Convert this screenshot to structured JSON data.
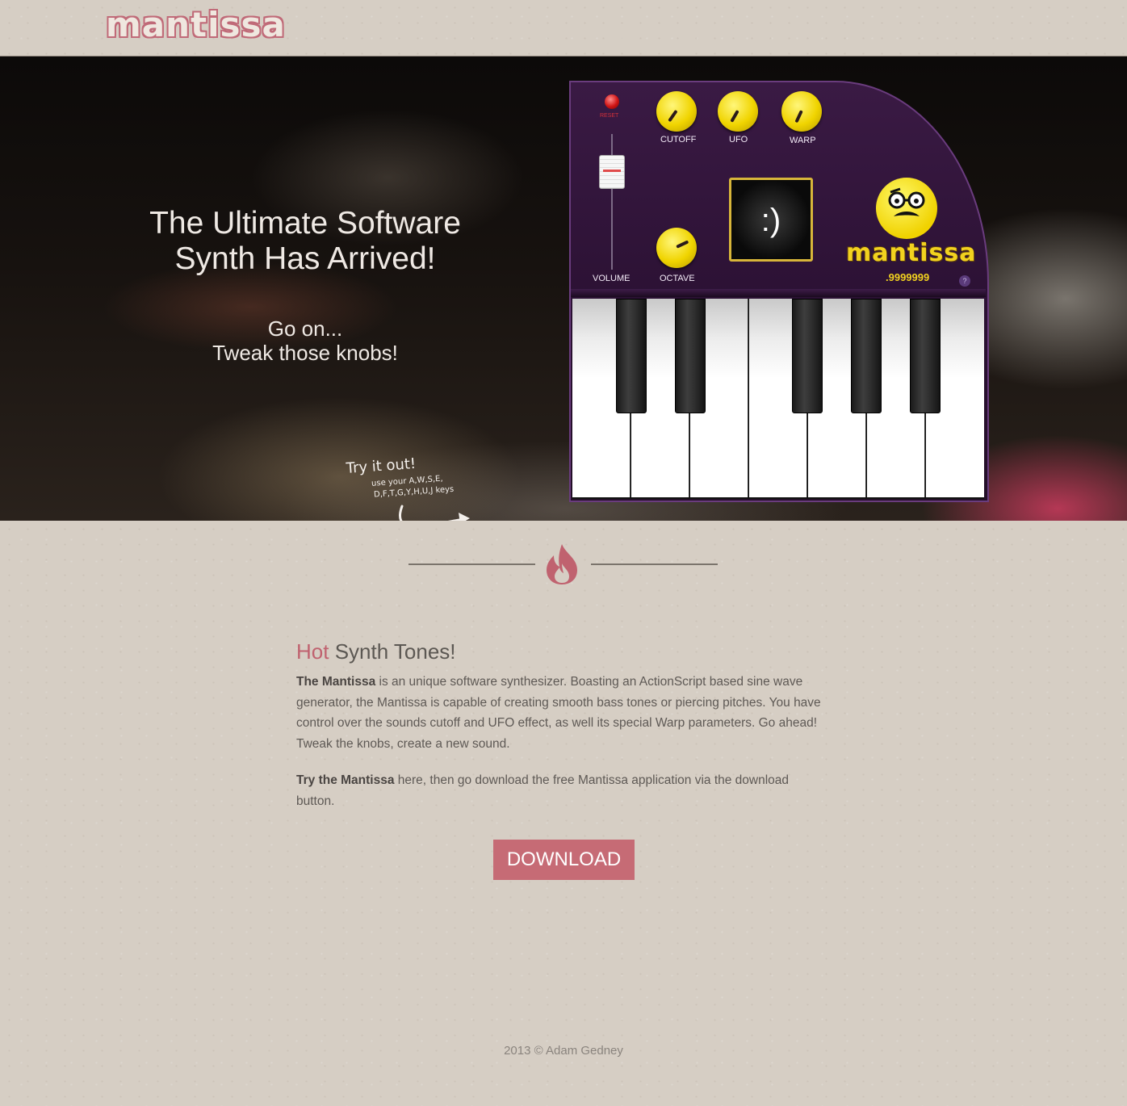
{
  "header": {
    "logo": "mantissa"
  },
  "hero": {
    "title_line1": "The Ultimate Software",
    "title_line2": "Synth Has Arrived!",
    "sub_line1": "Go on...",
    "sub_line2": "Tweak those knobs!",
    "try_title": "Try it out!",
    "try_keys_line1": "use your A,W,S,E,",
    "try_keys_line2": "D,F,T,G,Y,H,U,J keys"
  },
  "synth": {
    "reset_label": "RESET",
    "volume_label": "VOLUME",
    "knobs": [
      {
        "label": "CUTOFF"
      },
      {
        "label": "UFO"
      },
      {
        "label": "WARP"
      },
      {
        "label": "OCTAVE"
      }
    ],
    "screen": ":)",
    "brand": "mantissa",
    "version": ".9999999",
    "help": "?",
    "accent_color": "#2b1133",
    "knob_color": "#f0d400"
  },
  "content": {
    "divider_icon": "flame-icon",
    "headline_hot": "Hot",
    "headline_rest": " Synth Tones!",
    "p1_bold": "The Mantissa",
    "p1_text": " is an unique software synthesizer. Boasting an ActionScript based sine wave generator, the Mantissa is capable of creating smooth bass tones or piercing pitches. You have control over the sounds cutoff and UFO effect, as well its special Warp parameters. Go ahead! Tweak the knobs, create a new sound.",
    "p2_bold": "Try the Mantissa",
    "p2_text": " here, then go download the free Mantissa application via the download button.",
    "download_label": "DOWNLOAD",
    "accent_color": "#c66b75"
  },
  "footer": {
    "text": "2013 © Adam Gedney"
  }
}
